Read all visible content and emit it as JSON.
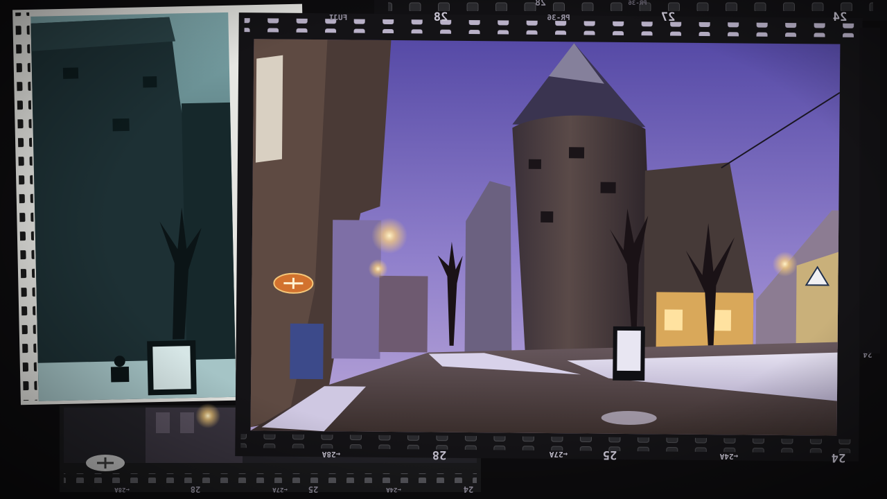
{
  "colors": {
    "background": "#0d0c0e",
    "film_strip": "#141316",
    "sprocket_main": "#b9b1c8",
    "sprocket_left": "#1a1a1a",
    "photo_frame": "#e6e6e2",
    "sky_top": "#5a4fa8",
    "sky_bottom": "#9a8ad0",
    "street_light": "#ffd27a"
  },
  "film": {
    "top_edge": {
      "brand": "FUJI",
      "frame_a": "28",
      "frame_b": "27",
      "frame_c": "24",
      "code": "PR-36"
    },
    "back_top_edge": {
      "frame_a": "28",
      "code": "PR-36"
    },
    "bottom_edge": {
      "mark_a": "28A",
      "frame_a": "28",
      "mark_b": "27A",
      "frame_b": "25",
      "mark_c": "24A",
      "frame_c": "24"
    },
    "lower_strip": {
      "mark_a": "28A",
      "frame_a": "28",
      "mark_b": "27A",
      "frame_b": "25",
      "mark_c": "24A",
      "frame_c": "24"
    },
    "side_edge": {
      "frame": "24"
    },
    "arrow_glyph": "←"
  },
  "photos": {
    "main": {
      "subject": "snowy street at dusk with round medieval tower"
    },
    "left": {
      "subject": "tower street in cyan monochrome"
    },
    "lower": {
      "subject": "dark street corner with shop sign"
    }
  },
  "icons": {
    "shop_sign": "shop-sign-icon",
    "lamps": "street-lamp-icon"
  }
}
